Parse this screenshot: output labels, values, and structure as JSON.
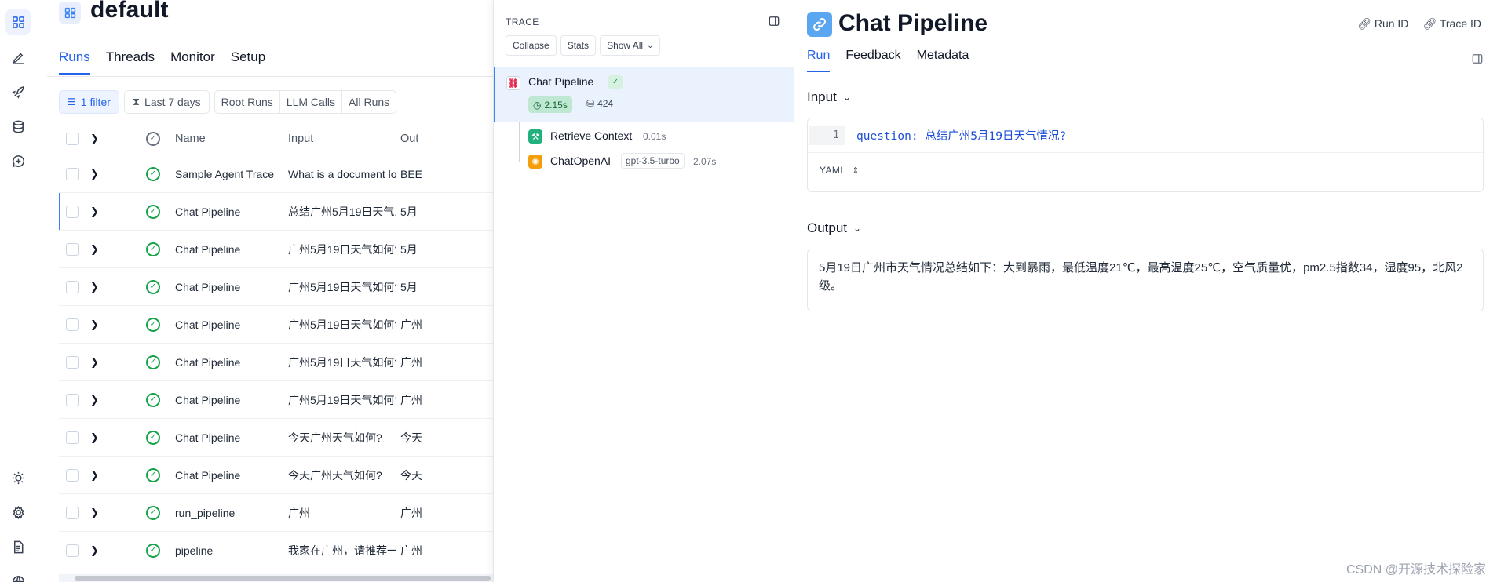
{
  "project": {
    "title": "default"
  },
  "runs_tabs": [
    "Runs",
    "Threads",
    "Monitor",
    "Setup"
  ],
  "filters": {
    "filter_chip": "1 filter",
    "time_chip": "Last 7 days",
    "segments": [
      "Root Runs",
      "LLM Calls",
      "All Runs"
    ]
  },
  "table": {
    "headers": {
      "name": "Name",
      "input": "Input",
      "output": "Out"
    },
    "rows": [
      {
        "name": "Sample Agent Trace",
        "input": "What is a document lo...",
        "output": "BEE"
      },
      {
        "name": "Chat Pipeline",
        "input": "总结广州5月19日天气...",
        "output": "5月"
      },
      {
        "name": "Chat Pipeline",
        "input": "广州5月19日天气如何?",
        "output": "5月"
      },
      {
        "name": "Chat Pipeline",
        "input": "广州5月19日天气如何?",
        "output": "5月"
      },
      {
        "name": "Chat Pipeline",
        "input": "广州5月19日天气如何?",
        "output": "广州"
      },
      {
        "name": "Chat Pipeline",
        "input": "广州5月19日天气如何?",
        "output": "广州"
      },
      {
        "name": "Chat Pipeline",
        "input": "广州5月19日天气如何?",
        "output": "广州"
      },
      {
        "name": "Chat Pipeline",
        "input": "今天广州天气如何?",
        "output": "今天"
      },
      {
        "name": "Chat Pipeline",
        "input": "今天广州天气如何?",
        "output": "今天"
      },
      {
        "name": "run_pipeline",
        "input": "广州",
        "output": "广州"
      },
      {
        "name": "pipeline",
        "input": "我家在广州，请推荐一...",
        "output": "广州"
      }
    ]
  },
  "trace": {
    "label": "TRACE",
    "controls": {
      "collapse": "Collapse",
      "stats": "Stats",
      "show": "Show All"
    },
    "root": {
      "name": "Chat Pipeline",
      "latency": "2.15s",
      "tokens": "424"
    },
    "children": [
      {
        "name": "Retrieve Context",
        "latency": "0.01s",
        "icon": "wrench-icon",
        "color": "#22b07d"
      },
      {
        "name": "ChatOpenAI",
        "model": "gpt-3.5-turbo",
        "latency": "2.07s",
        "icon": "openai-icon",
        "color": "#f59e0b"
      }
    ]
  },
  "detail": {
    "title": "Chat Pipeline",
    "actions": {
      "run_id": "Run ID",
      "trace_id": "Trace ID"
    },
    "tabs": [
      "Run",
      "Feedback",
      "Metadata"
    ],
    "input": {
      "label": "Input",
      "line_no": "1",
      "key": "question:",
      "value": "总结广州5月19日天气情况?",
      "format": "YAML"
    },
    "output": {
      "label": "Output",
      "text": "5月19日广州市天气情况总结如下：大到暴雨，最低温度21℃，最高温度25℃，空气质量优，pm2.5指数34，湿度95，北风2级。"
    }
  },
  "watermark": "CSDN @开源技术探险家",
  "colors": {
    "accent": "#2563eb",
    "success": "#16a34a"
  }
}
